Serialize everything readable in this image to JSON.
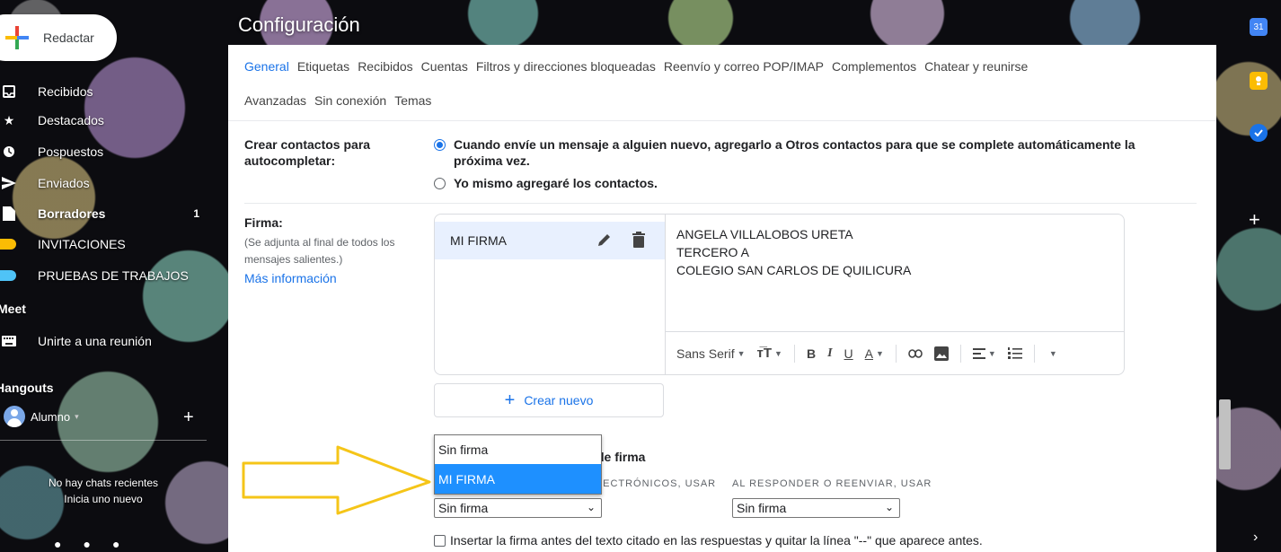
{
  "sidebar": {
    "compose_label": "Redactar",
    "items": [
      {
        "label": "Recibidos",
        "icon": "inbox-icon",
        "count": ""
      },
      {
        "label": "Destacados",
        "icon": "star-icon",
        "count": ""
      },
      {
        "label": "Pospuestos",
        "icon": "clock-icon",
        "count": ""
      },
      {
        "label": "Enviados",
        "icon": "send-icon",
        "count": ""
      },
      {
        "label": "Borradores",
        "icon": "draft-icon",
        "count": "1"
      },
      {
        "label": "INVITACIONES",
        "icon": "label-icon",
        "count": "",
        "color": "#fbbc04"
      },
      {
        "label": "PRUEBAS DE TRABAJOS",
        "icon": "label-icon",
        "count": "",
        "color": "#4fc3f7"
      }
    ],
    "meet_title": "Meet",
    "meet_join": "Unirte a una reunión",
    "hangouts_title": "Hangouts",
    "hangouts_user": "Alumno",
    "no_chats_line1": "No hay chats recientes",
    "no_chats_line2": "Inicia uno nuevo"
  },
  "settings": {
    "title": "Configuración",
    "tabs_row1": [
      "General",
      "Etiquetas",
      "Recibidos",
      "Cuentas",
      "Filtros y direcciones bloqueadas",
      "Reenvío y correo POP/IMAP",
      "Complementos",
      "Chatear y reunirse"
    ],
    "tabs_row2": [
      "Avanzadas",
      "Sin conexión",
      "Temas"
    ],
    "active_tab": "General",
    "contacts": {
      "label_line1": "Crear contactos para",
      "label_line2": "autocompletar:",
      "option1_line1": "Cuando envíe un mensaje a alguien nuevo, agregarlo a Otros contactos para que se complete automáticamente la",
      "option1_line2": "próxima vez.",
      "option2": "Yo mismo agregaré los contactos."
    },
    "signature": {
      "label": "Firma:",
      "sub_line1": "(Se adjunta al final de todos los",
      "sub_line2": "mensajes salientes.)",
      "more_info": "Más información",
      "item_name": "MI FIRMA",
      "text_lines": [
        "ANGELA VILLALOBOS URETA",
        "TERCERO A",
        "COLEGIO SAN CARLOS DE QUILICURA"
      ],
      "font": "Sans Serif",
      "create_new": "Crear nuevo"
    },
    "defaults": {
      "title_visible": "de firma",
      "col1_visible": "LECTRÓNICOS, USAR",
      "col2": "AL RESPONDER O REENVIAR, USAR",
      "select1_value": "Sin firma",
      "select2_value": "Sin firma",
      "dropdown_options": [
        "Sin firma",
        "MI FIRMA"
      ],
      "dropdown_highlighted": "MI FIRMA"
    },
    "insert_before": "Insertar la firma antes del texto citado en las respuestas y quitar la línea \"--\" que aparece antes."
  },
  "right_rail": {
    "calendar_day": "31"
  },
  "colors": {
    "accent": "#1a73e8",
    "annotation_arrow": "#f5c518",
    "dropdown_highlight": "#1e90ff"
  }
}
